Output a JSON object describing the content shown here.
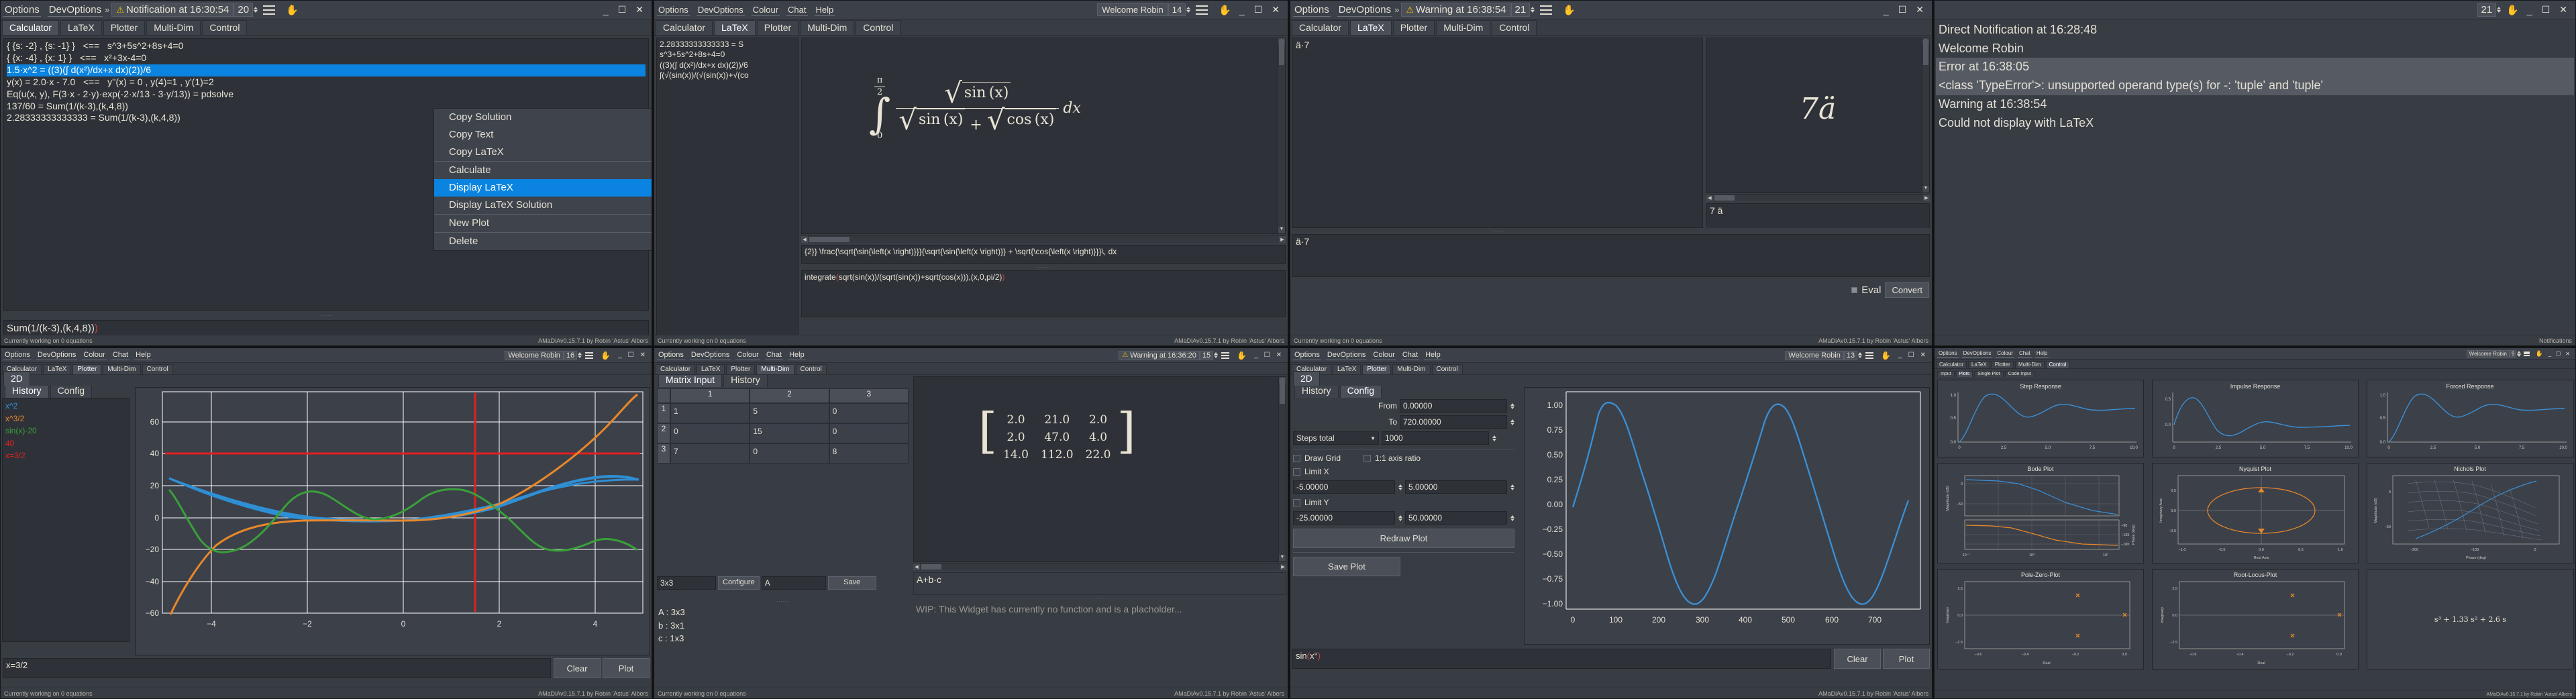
{
  "app": {
    "status_left": "Currently working on 0 equations",
    "status_right": "AMaDiAv0.15.7.1 by Robin 'Astus' Albers"
  },
  "win1": {
    "menu": [
      "Options",
      "DevOptions"
    ],
    "overflow_icon": "chevron-double-right-icon",
    "notification": "Notification at 16:30:54",
    "notification_count": "20",
    "tabs": [
      "Calculator",
      "LaTeX",
      "Plotter",
      "Multi-Dim",
      "Control"
    ],
    "active_tab": "Calculator",
    "history": [
      "{ {s: -2} , {s: -1} }   <==   s^3+5s^2+8s+4=0",
      "{ {x: -4} , {x: 1} }   <==   x²+3x-4=0",
      "1.5·x^2 = ((3)(∫ d(x²)/dx+x dx)(2))/6",
      "y(x) = 2.0·x - 7.0   <==   y''(x) = 0 , y(4)=1 , y'(1)=2",
      "Eq(u(x, y), F(3·x - 2·y)·exp(-2·x/13 - 3·y/13)) = pdsolve",
      "137/60 = Sum(1/(k-3),(k,4,8))",
      "2.28333333333333 = Sum(1/(k-3),(k,4,8))"
    ],
    "selected_index": 2,
    "input_value": "Sum(1/(k-3),(k,4,8))",
    "input_paren": ")",
    "context_menu": {
      "items": [
        "Copy Solution",
        "Copy Text",
        "Copy LaTeX",
        "Calculate",
        "Display LaTeX",
        "Display LaTeX Solution",
        "New Plot",
        "Delete"
      ],
      "highlighted": "Display LaTeX",
      "separator_after": [
        "Copy LaTeX",
        "Display LaTeX Solution",
        "New Plot"
      ]
    }
  },
  "win2": {
    "menu": [
      "Options",
      "DevOptions",
      "Colour",
      "Chat",
      "Help"
    ],
    "notification": "Welcome Robin",
    "notification_count": "14",
    "tabs": [
      "Calculator",
      "LaTeX",
      "Plotter",
      "Multi-Dim",
      "Control"
    ],
    "active_tab": "LaTeX",
    "history": [
      "2.28333333333333 = S",
      "s^3+5s^2+8s+4=0",
      "((3)(∫ d(x²)/dx+x dx)(2))/6",
      "∫(√(sin(x))/(√(sin(x))+√(co"
    ],
    "formula": {
      "lower_limit": "0",
      "upper_limit_num": "π",
      "upper_limit_den": "2",
      "numerator_fn": "sin (x)",
      "denominator_fn1": "sin (x)",
      "denominator_plus": "+",
      "denominator_fn2": "cos (x)",
      "dx": "dx"
    },
    "latex_code": "{2}} \\frac{\\sqrt{\\sin{\\left(x \\right)}}}{\\sqrt{\\sin{\\left(x \\right)}} + \\sqrt{\\cos{\\left(x \\right)}}}\\, dx",
    "input_value": "integrate",
    "input_open": "(",
    "input_mid": "sqrt(sin(x))/(sqrt(sin(x))+sqrt(cos(x))),(x,0,pi/2)",
    "input_close": ")"
  },
  "win3": {
    "menu": [
      "Options",
      "DevOptions"
    ],
    "overflow_icon": "chevron-double-right-icon",
    "notification": "Warning at 16:38:54",
    "notification_count": "21",
    "tabs": [
      "Calculator",
      "LaTeX",
      "Plotter",
      "Multi-Dim",
      "Control"
    ],
    "active_tab": "LaTeX",
    "left_text": "ä·7",
    "rendered_formula": "7ä",
    "rendered_caption": "7 ä",
    "bottom_text": "ä·7",
    "eval_label": "Eval",
    "convert_label": "Convert"
  },
  "win4": {
    "notification_count": "21",
    "notifications": [
      {
        "text": "Direct Notification at 16:28:48",
        "selected": false
      },
      {
        "text": "Welcome Robin",
        "selected": false
      },
      {
        "text": "Error at 16:38:05",
        "selected": true
      },
      {
        "text": "<class 'TypeError'>: unsupported operand type(s) for -: 'tuple' and 'tuple'",
        "selected": true
      },
      {
        "text": "Warning at 16:38:54",
        "selected": false
      },
      {
        "text": "Could not display with LaTeX",
        "selected": false
      }
    ],
    "status_right": "Notifications"
  },
  "win5": {
    "menu": [
      "Options",
      "DevOptions",
      "Colour",
      "Chat",
      "Help"
    ],
    "notification": "Welcome Robin",
    "notification_count": "16",
    "tabs": [
      "Calculator",
      "LaTeX",
      "Plotter",
      "Multi-Dim",
      "Control"
    ],
    "active_tab": "Plotter",
    "subtabs": [
      "2D"
    ],
    "active_subtab": "2D",
    "side_tabs": [
      "History",
      "Config"
    ],
    "active_side_tab": "History",
    "clear_label": "Clear",
    "plot_label": "Plot",
    "input_value": "x=3/2",
    "chart_data": {
      "type": "line",
      "title": "",
      "xlabel": "",
      "ylabel": "",
      "xlim": [
        -5,
        5
      ],
      "ylim": [
        -68,
        68
      ],
      "xticks": [
        -4,
        -2,
        0,
        2,
        4
      ],
      "yticks": [
        -60,
        -40,
        -20,
        0,
        20,
        40,
        60
      ],
      "grid": true,
      "legend_position": "left-panel",
      "series": [
        {
          "name": "x^2",
          "color": "#2f8fd4",
          "expr": "x^2"
        },
        {
          "name": "x^3/2",
          "color": "#e8882a",
          "expr": "x^3/2"
        },
        {
          "name": "sin(x)·20",
          "color": "#3aa03a",
          "expr": "sin(x)*20"
        },
        {
          "name": "40",
          "color": "#e02020",
          "expr": "40"
        },
        {
          "name": "x=3/2",
          "color": "#e02020",
          "expr": "x=1.5"
        }
      ]
    }
  },
  "win6": {
    "menu": [
      "Options",
      "DevOptions",
      "Colour",
      "Chat",
      "Help"
    ],
    "notification": "Warning at 16:36:20",
    "notification_count": "15",
    "tabs": [
      "Calculator",
      "LaTeX",
      "Plotter",
      "Multi-Dim",
      "Control"
    ],
    "active_tab": "Multi-Dim",
    "side_tabs": [
      "Matrix Input",
      "History"
    ],
    "active_side_tab": "Matrix Input",
    "matrix_headers": [
      "1",
      "2",
      "3"
    ],
    "matrix_rows": [
      {
        "label": "1",
        "cells": [
          "1",
          "5",
          "0"
        ]
      },
      {
        "label": "2",
        "cells": [
          "0",
          "15",
          "0"
        ]
      },
      {
        "label": "3",
        "cells": [
          "7",
          "0",
          "8"
        ]
      }
    ],
    "size_value": "3x3",
    "configure_label": "Configure",
    "name_value": "A",
    "save_label": "Save",
    "variables": [
      "A : 3x3",
      "b : 3x1",
      "c : 1x3"
    ],
    "result_matrix": [
      [
        "2.0",
        "21.0",
        "2.0"
      ],
      [
        "2.0",
        "47.0",
        "4.0"
      ],
      [
        "14.0",
        "112.0",
        "22.0"
      ]
    ],
    "expression": "A+b·c",
    "placeholder_text": "WIP: This Widget has currently no function and is a placholder..."
  },
  "win7": {
    "menu": [
      "Options",
      "DevOptions",
      "Colour",
      "Chat",
      "Help"
    ],
    "notification": "Welcome Robin",
    "notification_count": "13",
    "tabs": [
      "Calculator",
      "LaTeX",
      "Plotter",
      "Multi-Dim",
      "Control"
    ],
    "active_tab": "Plotter",
    "subtabs": [
      "2D"
    ],
    "active_subtab": "2D",
    "side_tabs": [
      "History",
      "Config"
    ],
    "active_side_tab": "Config",
    "config": {
      "from_label": "From",
      "from_value": "0.00000",
      "to_label": "To",
      "to_value": "720.00000",
      "steps_mode": "Steps total",
      "steps_value": "1000",
      "draw_grid_label": "Draw Grid",
      "draw_grid_checked": false,
      "axis_ratio_label": "1:1 axis ratio",
      "axis_ratio_checked": false,
      "limit_x_label": "Limit X",
      "limit_x_checked": false,
      "xmin": "-5.00000",
      "xmax": "5.00000",
      "limit_y_label": "Limit Y",
      "limit_y_checked": false,
      "ymin": "-25.00000",
      "ymax": "50.00000",
      "redraw_label": "Redraw Plot",
      "save_plot_label": "Save Plot"
    },
    "input_value": "sin",
    "input_open": "(",
    "input_mid": "x°",
    "input_close": ")",
    "clear_label": "Clear",
    "plot_label": "Plot",
    "chart_data": {
      "type": "line",
      "title": "",
      "xlabel": "",
      "ylabel": "",
      "xlim": [
        0,
        720
      ],
      "ylim": [
        -1.08,
        1.08
      ],
      "xticks": [
        0,
        100,
        200,
        300,
        400,
        500,
        600,
        700
      ],
      "yticks": [
        -1.0,
        -0.75,
        -0.5,
        -0.25,
        0.0,
        0.25,
        0.5,
        0.75,
        1.0
      ],
      "grid": false,
      "series": [
        {
          "name": "sin(x°)",
          "color": "#3b8fd4",
          "expr": "sin(x deg)",
          "period": 360,
          "amplitude": 1
        }
      ]
    }
  },
  "win8": {
    "menu": [
      "Options",
      "DevOptions",
      "Colour",
      "Chat",
      "Help"
    ],
    "notification": "Welcome Robin",
    "notification_count": "9",
    "tabs": [
      "Calculator",
      "LaTeX",
      "Plotter",
      "Multi-Dim",
      "Control"
    ],
    "active_tab": "Control",
    "subtabs": [
      "Input",
      "Plots",
      "Single Plot",
      "Code Input"
    ],
    "active_subtab": "Plots",
    "transfer_function": "s³ + 1.33 s² + 2.6 s",
    "charts": [
      {
        "type": "line",
        "title": "Step Response",
        "xticks": [
          0,
          2.5,
          5.0,
          7.5,
          10.0
        ],
        "yticks": [
          0.0,
          0.5,
          1.0
        ],
        "xlim": [
          0,
          11
        ],
        "ylim": [
          0,
          1.3
        ],
        "color": "#3b8fd4"
      },
      {
        "type": "line",
        "title": "Impulse Response",
        "xticks": [
          0,
          2.5,
          5.0,
          7.5,
          10.0
        ],
        "yticks": [
          0.0,
          0.5
        ],
        "xlim": [
          0,
          11
        ],
        "ylim": [
          -0.3,
          0.8
        ],
        "color": "#3b8fd4"
      },
      {
        "type": "line",
        "title": "Forced Response",
        "xticks": [
          0,
          2.5,
          5.0,
          7.5,
          10.0
        ],
        "yticks": [
          0.0,
          0.5,
          1.0
        ],
        "xlim": [
          0,
          11
        ],
        "ylim": [
          0,
          1.3
        ],
        "color": "#3b8fd4"
      },
      {
        "type": "line",
        "title": "Bode Plot",
        "xlabel": "",
        "ylabel_mag": "Magnitude (dB)",
        "ylabel_phase": "Phase (deg)",
        "yticks_mag": [
          0,
          -50
        ],
        "yticks_phase": [
          -90,
          -135,
          -180
        ],
        "xticks": [
          "10⁻¹",
          "10⁰",
          "10¹"
        ],
        "color_mag": "#3b8fd4",
        "color_phase": "#e8882a"
      },
      {
        "type": "line",
        "title": "Nyquist Plot",
        "xlabel": "Real Axis",
        "ylabel": "Imaginary Axis",
        "xticks": [
          -1.0,
          -0.5,
          0.0,
          0.5,
          1.0
        ],
        "yticks": [
          -0.5,
          0.0,
          0.5
        ],
        "color": "#e8882a"
      },
      {
        "type": "scatter",
        "title": "Nichols Plot",
        "xlabel": "Phase (deg)",
        "ylabel": "Magnitude (dB)",
        "xticks": [
          -200,
          -100,
          0
        ],
        "yticks": [
          -50,
          0
        ],
        "color": "#9aa0aa"
      },
      {
        "type": "scatter",
        "title": "Pole-Zero-Plot",
        "xlabel": "Real",
        "ylabel": "Imaginary",
        "xticks": [
          -0.6,
          -0.4,
          -0.2,
          0.0
        ],
        "yticks": [
          -2.5,
          0.0,
          2.5
        ],
        "color": "#e8882a"
      },
      {
        "type": "scatter",
        "title": "Root-Locus-Plot",
        "xlabel": "Real",
        "ylabel": "Imaginary",
        "xticks": [
          -0.6,
          -0.4,
          -0.2,
          0.0
        ],
        "yticks": [
          -2.5,
          0.0,
          2.5
        ],
        "color": "#e8882a"
      }
    ]
  }
}
